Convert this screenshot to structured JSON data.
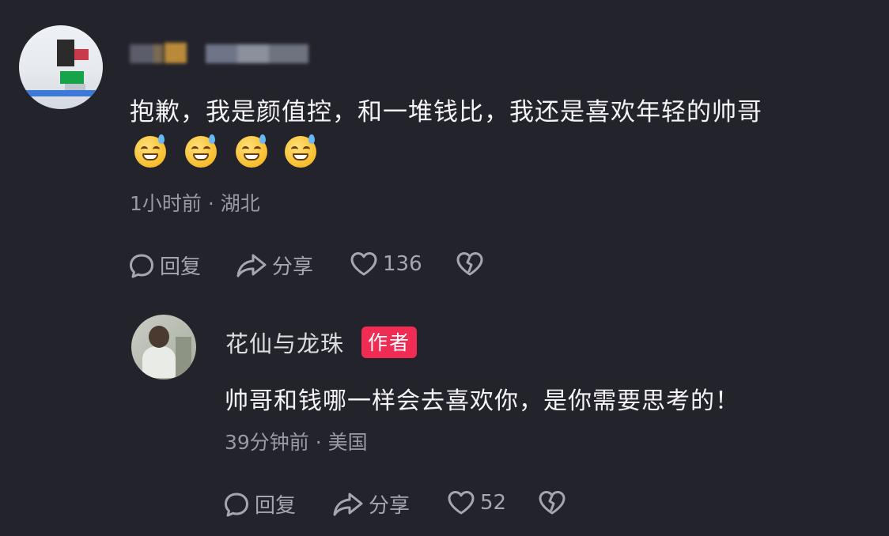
{
  "colors": {
    "background": "#23232c",
    "text_primary": "#f4f4f6",
    "text_meta": "#9a9aa4",
    "author_badge": "#f02c54"
  },
  "comment": {
    "text": "抱歉，我是颜值控，和一堆钱比，我还是喜欢年轻的帅哥",
    "emojis": [
      "grinning-sweat-emoji",
      "grinning-sweat-emoji",
      "grinning-sweat-emoji",
      "grinning-sweat-emoji"
    ],
    "meta": "1小时前 · 湖北",
    "actions": {
      "reply_label": "回复",
      "share_label": "分享",
      "like_count": "136"
    }
  },
  "reply": {
    "username": "花仙与龙珠",
    "badge": "作者",
    "text": "帅哥和钱哪一样会去喜欢你，是你需要思考的！",
    "meta": "39分钟前 · 美国",
    "actions": {
      "reply_label": "回复",
      "share_label": "分享",
      "like_count": "52"
    }
  }
}
